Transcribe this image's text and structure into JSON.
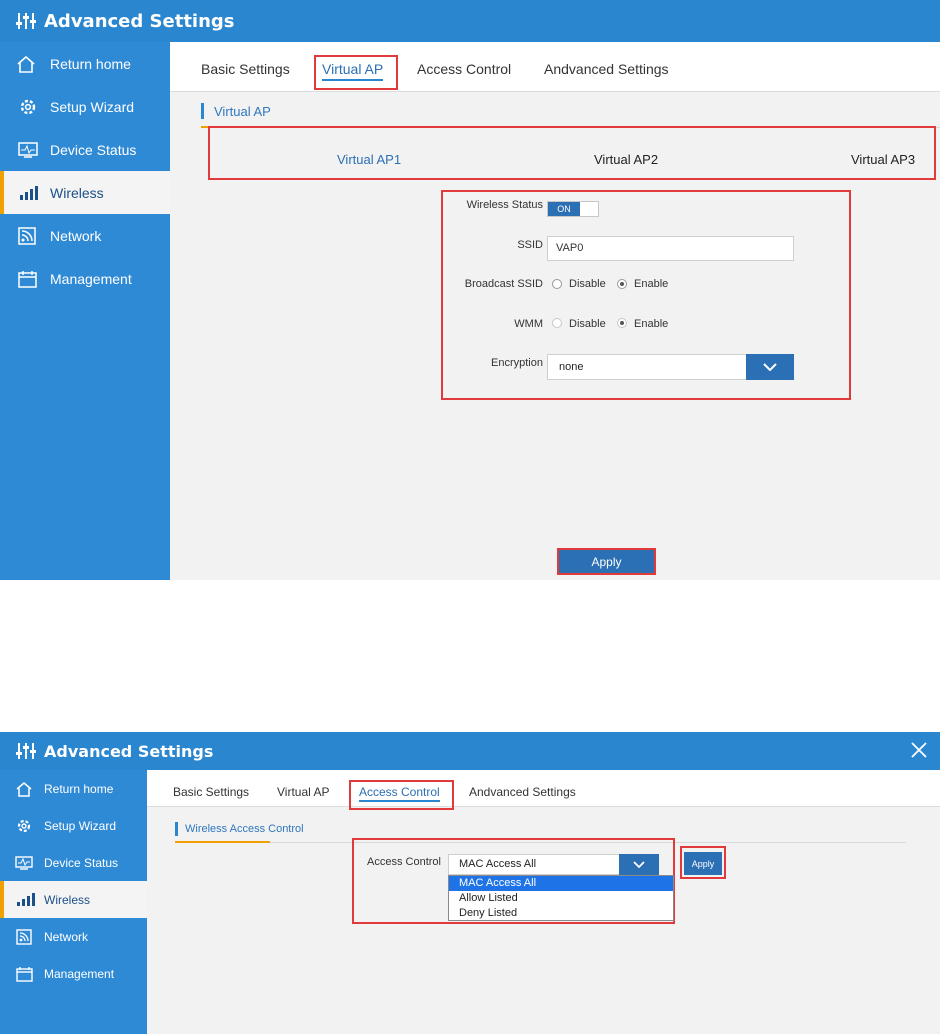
{
  "app_title": "Advanced Settings",
  "sidebar": {
    "items": [
      {
        "label": "Return home",
        "icon": "home-icon"
      },
      {
        "label": "Setup Wizard",
        "icon": "gear-icon"
      },
      {
        "label": "Device Status",
        "icon": "monitor-icon"
      },
      {
        "label": "Wireless",
        "icon": "signal-bars-icon",
        "active": true
      },
      {
        "label": "Network",
        "icon": "rss-icon"
      },
      {
        "label": "Management",
        "icon": "calendar-icon"
      }
    ]
  },
  "tabs": [
    "Basic Settings",
    "Virtual AP",
    "Access Control",
    "Andvanced Settings"
  ],
  "screen1": {
    "active_tab": "Virtual AP",
    "section_title": "Virtual AP",
    "vap_tabs": [
      "Virtual AP1",
      "Virtual AP2",
      "Virtual AP3"
    ],
    "form": {
      "wireless_status_label": "Wireless Status",
      "toggle_label": "ON",
      "ssid_label": "SSID",
      "ssid_value": "VAP0",
      "broadcast_label": "Broadcast SSID",
      "wmm_label": "WMM",
      "disable_label": "Disable",
      "enable_label": "Enable",
      "encryption_label": "Encryption",
      "encryption_value": "none"
    },
    "apply_label": "Apply"
  },
  "screen2": {
    "active_tab": "Access Control",
    "section_title": "Wireless Access Control",
    "access_label": "Access Control",
    "select_value": "MAC Access All",
    "options": [
      "MAC Access All",
      "Allow Listed",
      "Deny Listed"
    ],
    "apply_label": "Apply"
  },
  "colors": {
    "header_blue": "#2b86d0",
    "sidebar_blue": "#2f8ad6",
    "accent_orange": "#f0a000",
    "highlight_red": "#e03a3a",
    "button_blue": "#2b6fb4"
  }
}
